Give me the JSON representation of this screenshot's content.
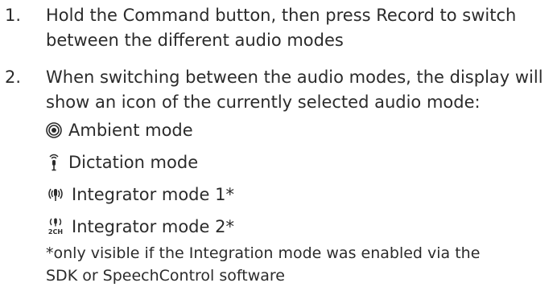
{
  "steps": [
    {
      "number": "1.",
      "text": "Hold the Command button, then press Record to switch between the different audio modes"
    },
    {
      "number": "2.",
      "text": "When switching between the audio modes, the display will show an icon of the currently selected audio mode:"
    }
  ],
  "modes": [
    {
      "icon": "ambient-mode-icon",
      "label": "Ambient mode"
    },
    {
      "icon": "dictation-mode-icon",
      "label": "Dictation mode"
    },
    {
      "icon": "integrator-mode-1-icon",
      "label": "Integrator mode 1*"
    },
    {
      "icon": "integrator-mode-2-icon",
      "label": "Integrator mode 2*",
      "icon_text": "2CH"
    }
  ],
  "footnote": "*only visible if the Integration mode was enabled via the SDK or SpeechControl software",
  "colors": {
    "text": "#2b2b2b",
    "background": "#ffffff"
  }
}
